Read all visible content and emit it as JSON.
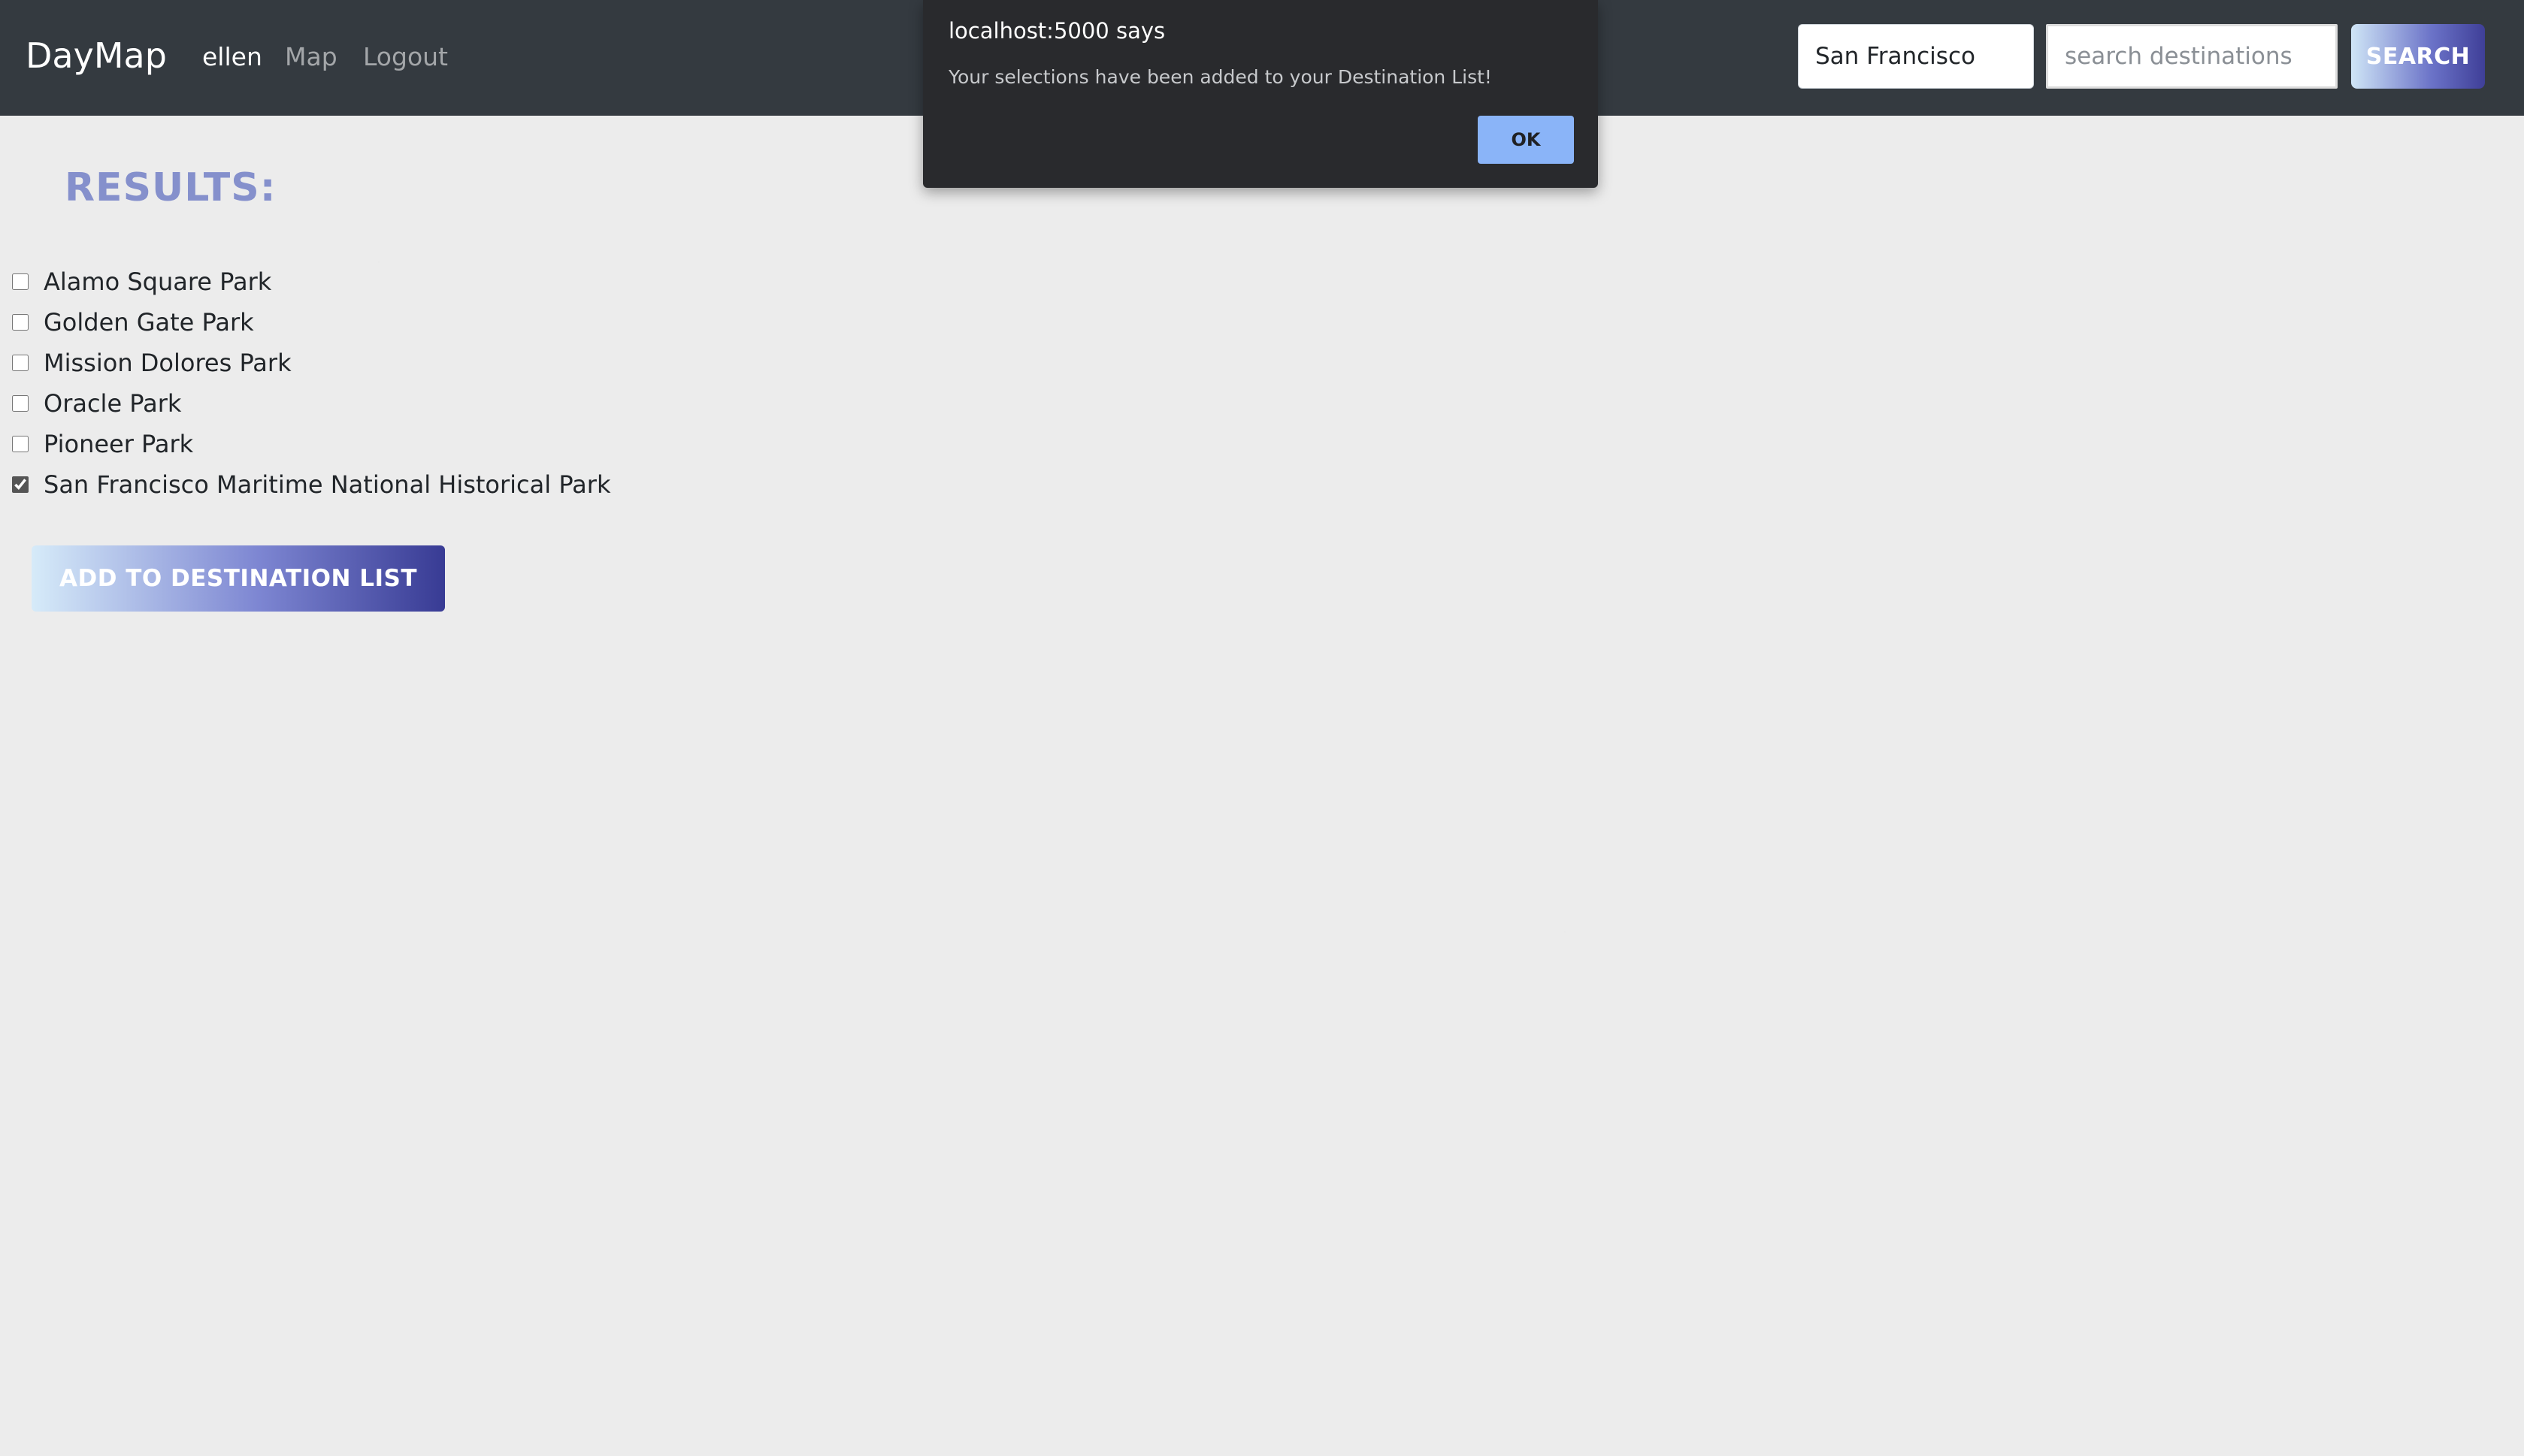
{
  "navbar": {
    "brand": "DayMap",
    "user": "ellen",
    "links": {
      "map": "Map",
      "logout": "Logout"
    },
    "city": {
      "value": "San Francisco"
    },
    "search": {
      "placeholder": "search destinations",
      "button_label": "SEARCH"
    }
  },
  "results": {
    "heading": "RESULTS:",
    "items": [
      {
        "label": "Alamo Square Park",
        "checked": false
      },
      {
        "label": "Golden Gate Park",
        "checked": false
      },
      {
        "label": "Mission Dolores Park",
        "checked": false
      },
      {
        "label": "Oracle Park",
        "checked": false
      },
      {
        "label": "Pioneer Park",
        "checked": false
      },
      {
        "label": "San Francisco Maritime National Historical Park",
        "checked": true
      }
    ],
    "add_button_label": "ADD TO DESTINATION LIST"
  },
  "alert": {
    "title": "localhost:5000 says",
    "message": "Your selections have been added to your Destination List!",
    "ok_label": "OK"
  },
  "colors": {
    "navbar": "#343a40",
    "heading": "#8590cc",
    "ok_button": "#8ab4f8"
  }
}
